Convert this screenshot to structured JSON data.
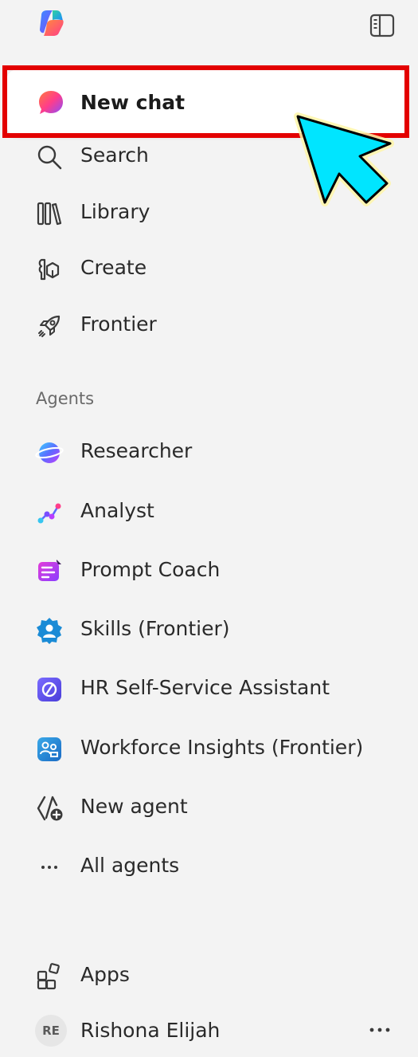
{
  "app": {
    "logo_icon": "copilot-logo",
    "panel_toggle_icon": "sidebar-toggle-icon"
  },
  "nav": {
    "new_chat": {
      "label": "New chat",
      "icon": "new-chat-bubble-icon"
    },
    "items": [
      {
        "label": "Search",
        "icon": "search-icon"
      },
      {
        "label": "Library",
        "icon": "library-icon"
      },
      {
        "label": "Create",
        "icon": "create-icon"
      },
      {
        "label": "Frontier",
        "icon": "rocket-icon"
      }
    ]
  },
  "agents": {
    "heading": "Agents",
    "items": [
      {
        "label": "Researcher",
        "icon": "researcher-icon"
      },
      {
        "label": "Analyst",
        "icon": "analyst-icon"
      },
      {
        "label": "Prompt Coach",
        "icon": "prompt-coach-icon"
      },
      {
        "label": "Skills (Frontier)",
        "icon": "skills-icon"
      },
      {
        "label": "HR Self-Service Assistant",
        "icon": "hr-assistant-icon"
      },
      {
        "label": "Workforce Insights (Frontier)",
        "icon": "workforce-insights-icon"
      },
      {
        "label": "New agent",
        "icon": "new-agent-icon"
      },
      {
        "label": "All agents",
        "icon": "ellipsis-icon"
      }
    ]
  },
  "footer": {
    "apps_label": "Apps",
    "apps_icon": "apps-icon",
    "user": {
      "initials": "RE",
      "name": "Rishona Elijah"
    },
    "more_icon": "more-options-icon"
  },
  "colors": {
    "background": "#f3f3f3",
    "highlight": "#e30000",
    "cursor": "#00e5ff"
  }
}
